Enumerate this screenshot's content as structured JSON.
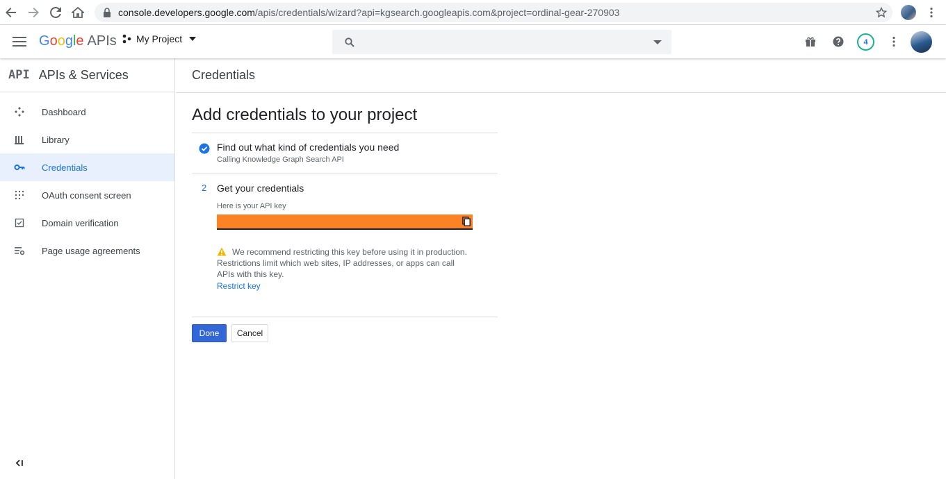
{
  "browser": {
    "url_host": "console.developers.google.com",
    "url_path": "/apis/credentials/wizard?api=kgsearch.googleapis.com&project=ordinal-gear-270903"
  },
  "header": {
    "logo_google": "Google",
    "logo_apis": "APIs",
    "project_name": "My Project",
    "search_placeholder": "",
    "notification_count": "4"
  },
  "sidebar": {
    "logo_text": "API",
    "title": "APIs & Services",
    "items": [
      {
        "label": "Dashboard",
        "icon": "dashboard-icon"
      },
      {
        "label": "Library",
        "icon": "library-icon"
      },
      {
        "label": "Credentials",
        "icon": "key-icon",
        "active": true
      },
      {
        "label": "OAuth consent screen",
        "icon": "oauth-icon"
      },
      {
        "label": "Domain verification",
        "icon": "checkbox-icon"
      },
      {
        "label": "Page usage agreements",
        "icon": "settings-list-icon"
      }
    ]
  },
  "main": {
    "header_title": "Credentials",
    "heading": "Add credentials to your project",
    "step1": {
      "title": "Find out what kind of credentials you need",
      "subtitle": "Calling Knowledge Graph Search API"
    },
    "step2": {
      "number": "2",
      "title": "Get your credentials",
      "key_label": "Here is your API key"
    },
    "warning": {
      "line1": "We recommend restricting this key before using it in production.",
      "line2": "Restrictions limit which web sites, IP addresses, or apps can call",
      "line3": "APIs with this key.",
      "link": "Restrict key"
    },
    "done_label": "Done",
    "cancel_label": "Cancel"
  },
  "colors": {
    "accent": "#1a73e8",
    "primary_button": "#3367d6",
    "redacted_key": "#fb8325",
    "active_nav_bg": "#e8f0fe",
    "warning": "#f4b400"
  }
}
